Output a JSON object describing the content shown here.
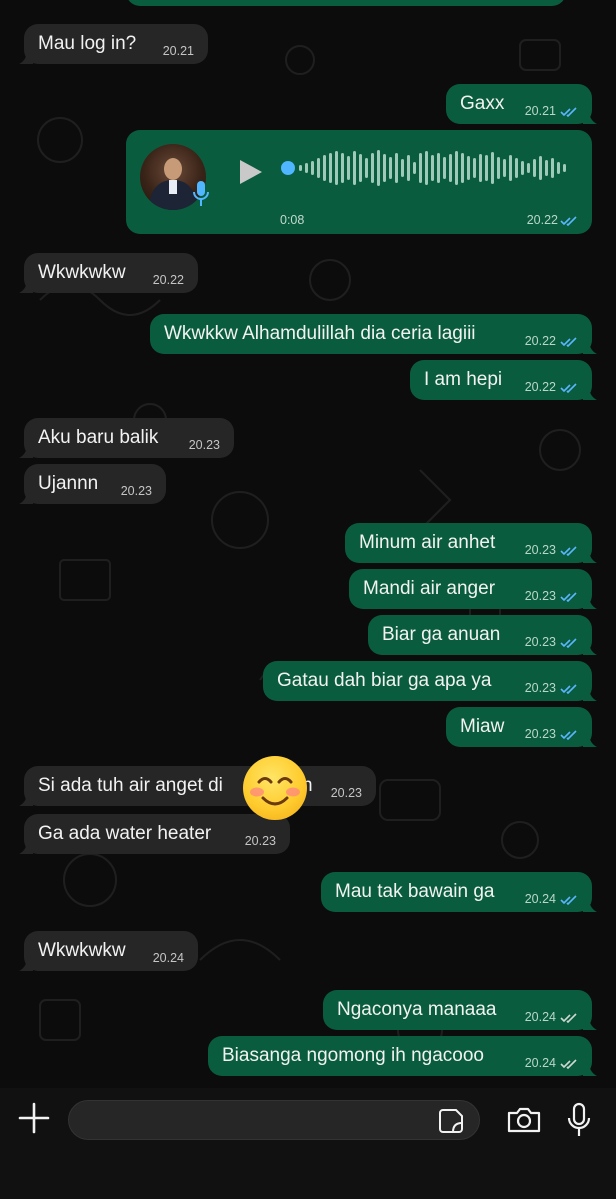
{
  "messages": [
    {
      "side": "in",
      "text": "Mau log in?",
      "time": "20.21"
    },
    {
      "side": "out",
      "text": "Gaxx",
      "time": "20.21"
    },
    {
      "side": "in",
      "text": "Wkwkwkw",
      "time": "20.22"
    },
    {
      "side": "out",
      "text": "Wkwkkw Alhamdulillah dia ceria lagiii",
      "time": "20.22"
    },
    {
      "side": "out",
      "text": "I am hepi",
      "time": "20.22"
    },
    {
      "side": "in",
      "text": "Aku baru balik",
      "time": "20.23"
    },
    {
      "side": "in",
      "text": "Ujannn",
      "time": "20.23"
    },
    {
      "side": "out",
      "text": "Minum air anhet",
      "time": "20.23"
    },
    {
      "side": "out",
      "text": "Mandi air anger",
      "time": "20.23"
    },
    {
      "side": "out",
      "text": "Biar ga anuan",
      "time": "20.23"
    },
    {
      "side": "out",
      "text": "Gatau dah biar ga apa ya",
      "time": "20.23"
    },
    {
      "side": "out",
      "text": "Miaw",
      "time": "20.23"
    },
    {
      "side": "in",
      "text": "Si ada tuh air anget di",
      "text_tail": "n",
      "time": "20.23"
    },
    {
      "side": "in",
      "text": "Ga ada water heater",
      "time": "20.23"
    },
    {
      "side": "out",
      "text": "Mau tak bawain ga",
      "time": "20.24"
    },
    {
      "side": "in",
      "text": "Wkwkwkw",
      "time": "20.24"
    },
    {
      "side": "out",
      "text": "Ngaconya manaaa",
      "time": "20.24"
    },
    {
      "side": "out",
      "text": "Biasanga ngomong ih ngacooo",
      "time": "20.24"
    }
  ],
  "voice_note": {
    "duration": "0:08",
    "time": "20.22",
    "progress": 0.0
  },
  "composer": {
    "value": "",
    "placeholder": ""
  },
  "icons": {
    "add": "plus-icon",
    "sticker": "sticker-icon",
    "camera": "camera-icon",
    "mic": "microphone-icon",
    "play": "play-icon",
    "read": "double-check-icon"
  },
  "colors": {
    "outgoing": "#0a5c3e",
    "incoming": "#262626",
    "read_tick": "#5bb5ff",
    "background": "#0c0c0c"
  }
}
